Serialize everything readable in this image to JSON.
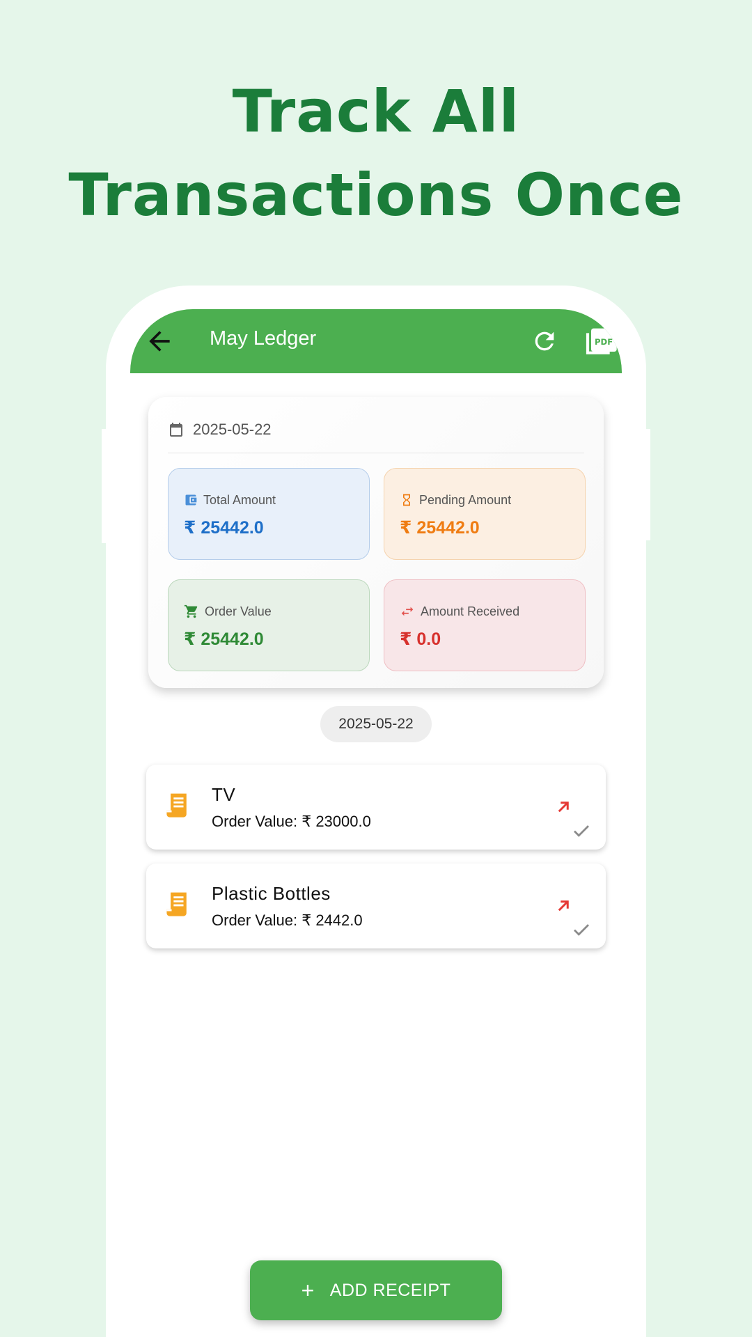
{
  "headline": {
    "line1": "Track All",
    "line2": "Transactions Once"
  },
  "appbar": {
    "title": "May Ledger",
    "back_icon": "arrow-back-icon",
    "refresh_icon": "refresh-icon",
    "pdf_icon": "pdf-icon"
  },
  "summary": {
    "date": "2025-05-22",
    "stats": [
      {
        "label": "Total Amount",
        "value": "₹ 25442.0",
        "icon": "wallet-icon",
        "color": "#1e6fc8"
      },
      {
        "label": "Pending Amount",
        "value": "₹ 25442.0",
        "icon": "hourglass-icon",
        "color": "#ef7c12"
      },
      {
        "label": "Order Value",
        "value": "₹ 25442.0",
        "icon": "cart-icon",
        "color": "#2f8a36"
      },
      {
        "label": "Amount Received",
        "value": "₹ 0.0",
        "icon": "swap-icon",
        "color": "#d7312d"
      }
    ]
  },
  "date_chip": "2025-05-22",
  "items": [
    {
      "name": "TV",
      "subtitle": "Order Value: ₹ 23000.0"
    },
    {
      "name": "Plastic Bottles",
      "subtitle": "Order Value: ₹ 2442.0"
    }
  ],
  "fab": {
    "label": "ADD RECEIPT",
    "plus": "+"
  },
  "colors": {
    "background": "#e5f6ea",
    "headline": "#1b7d3a",
    "appbar": "#4caf50"
  }
}
